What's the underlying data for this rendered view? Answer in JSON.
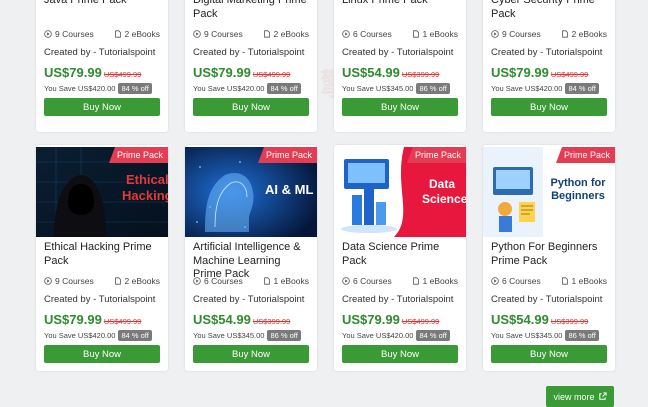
{
  "cards": [
    {
      "title": "Java Prime Pack",
      "courses": "9 Courses",
      "ebooks": "2 eBooks",
      "creator": "Created by - Tutorialspoint",
      "price": "US$79.99",
      "old_price": "US$499.99",
      "save": "You Save US$420.00",
      "pct": "84 % off",
      "buy": "Buy Now"
    },
    {
      "title": "Digital Marketing Prime Pack",
      "courses": "9 Courses",
      "ebooks": "2 eBooks",
      "creator": "Created by - Tutorialspoint",
      "price": "US$79.99",
      "old_price": "US$499.99",
      "save": "You Save US$420.00",
      "pct": "84 % off",
      "buy": "Buy Now"
    },
    {
      "title": "Linux Prime Pack",
      "courses": "6 Courses",
      "ebooks": "1 eBooks",
      "creator": "Created by - Tutorialspoint",
      "price": "US$54.99",
      "old_price": "US$399.99",
      "save": "You Save US$345.00",
      "pct": "86 % off",
      "buy": "Buy Now"
    },
    {
      "title": "Cyber Security Prime Pack",
      "courses": "9 Courses",
      "ebooks": "2 eBooks",
      "creator": "Created by - Tutorialspoint",
      "price": "US$79.99",
      "old_price": "US$499.99",
      "save": "You Save US$420.00",
      "pct": "84 % off",
      "buy": "Buy Now"
    },
    {
      "title": "Ethical Hacking Prime Pack",
      "badge": "Prime Pack",
      "thumb": "Ethical Hacking",
      "courses": "9 Courses",
      "ebooks": "2 eBooks",
      "creator": "Created by - Tutorialspoint",
      "price": "US$79.99",
      "old_price": "US$499.99",
      "save": "You Save US$420.00",
      "pct": "84 % off",
      "buy": "Buy Now"
    },
    {
      "title": "Artificial Intelligence & Machine Learning Prime Pack",
      "badge": "Prime Pack",
      "thumb": "AI & ML",
      "courses": "6 Courses",
      "ebooks": "1 eBooks",
      "creator": "Created by - Tutorialspoint",
      "price": "US$54.99",
      "old_price": "US$399.99",
      "save": "You Save US$345.00",
      "pct": "86 % off",
      "buy": "Buy Now"
    },
    {
      "title": "Data Science Prime Pack",
      "badge": "Prime Pack",
      "thumb": "Data Science",
      "courses": "6 Courses",
      "ebooks": "1 eBooks",
      "creator": "Created by - Tutorialspoint",
      "price": "US$79.99",
      "old_price": "US$499.99",
      "save": "You Save US$420.00",
      "pct": "84 % off",
      "buy": "Buy Now"
    },
    {
      "title": "Python For Beginners Prime Pack",
      "badge": "Prime Pack",
      "thumb": "Python for Beginners",
      "courses": "6 Courses",
      "ebooks": "1 eBooks",
      "creator": "Created by - Tutorialspoint",
      "price": "US$54.99",
      "old_price": "US$399.99",
      "save": "You Save US$345.00",
      "pct": "86 % off",
      "buy": "Buy Now"
    }
  ],
  "view_more": "view more",
  "colors": {
    "accent": "#3a9a36",
    "price": "#2e8b2e",
    "strike": "#e03030",
    "badge": "#e43c52"
  },
  "icons": {
    "courses": "play-circle-icon",
    "ebooks": "document-icon",
    "view_more": "external-link-icon"
  }
}
